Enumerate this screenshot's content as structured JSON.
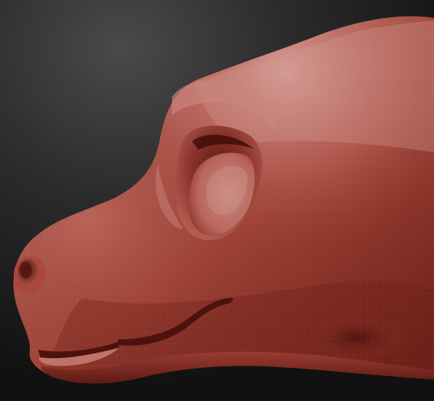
{
  "scene": {
    "subject_icon": "sculpted-creature-head-icon",
    "colors": {
      "background_top": "#484848",
      "background_bottom": "#121212",
      "clay_light": "#c7847d",
      "clay_mid": "#a8473b",
      "clay_dark": "#5b1a14",
      "clay_shadow": "#3a0f0c",
      "wireframe": "#f2d3cd"
    }
  }
}
